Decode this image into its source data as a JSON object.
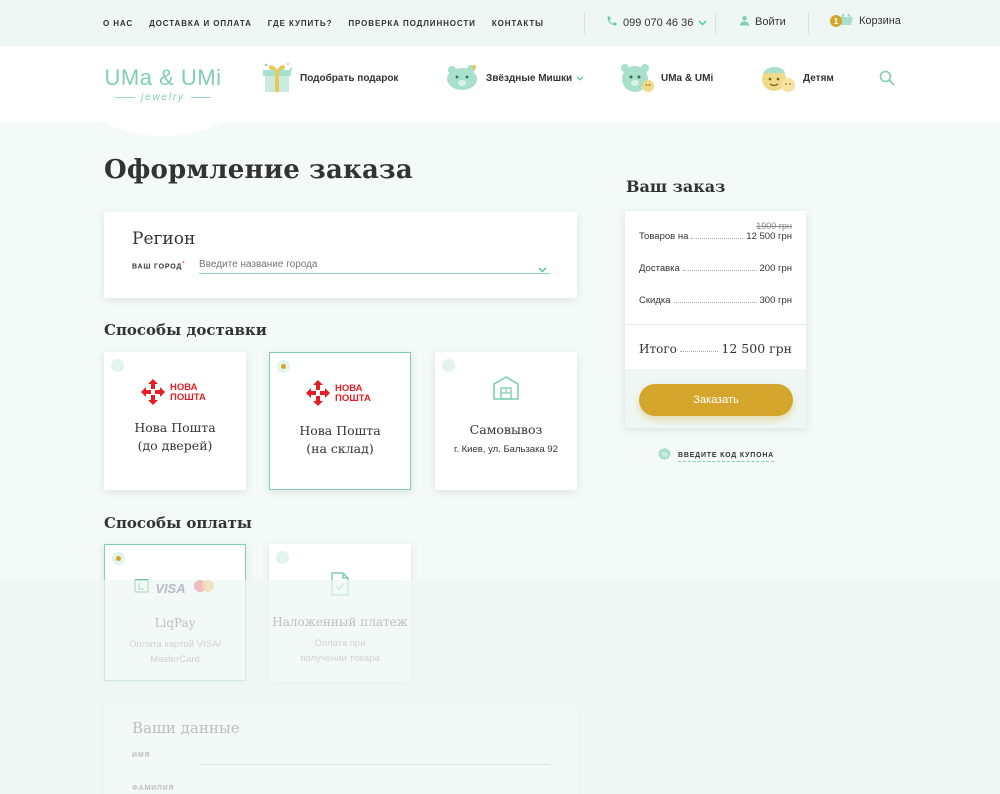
{
  "topbar": {
    "nav": [
      "О нас",
      "Доставка и оплата",
      "Где купить?",
      "Проверка подлинности",
      "Контакты"
    ],
    "phone": "099 070 46 36",
    "login": "Войти",
    "cart_count": "1",
    "cart_label": "Корзина"
  },
  "header": {
    "logo_main": "UMa & UMi",
    "logo_sub": "jewelry",
    "nav": [
      {
        "label": "Подобрать подарок",
        "icon": "gift-icon"
      },
      {
        "label": "Звёздные Мишки",
        "icon": "bear-icon"
      },
      {
        "label": "UMa & UMi",
        "icon": "bears-icon"
      },
      {
        "label": "Детям",
        "icon": "kids-icon"
      }
    ]
  },
  "page": {
    "title": "Оформление заказа"
  },
  "region": {
    "title": "Регион",
    "city_label": "Ваш город",
    "city_required": "*",
    "city_placeholder": "Введите название города"
  },
  "delivery": {
    "title": "Способы доставки",
    "options": [
      {
        "logo_line1": "НОВА",
        "logo_line2": "ПОШТА",
        "name_line1": "Нова Пошта",
        "name_line2": "(до дверей)",
        "selected": false
      },
      {
        "logo_line1": "НОВА",
        "logo_line2": "ПОШТА",
        "name_line1": "Нова Пошта",
        "name_line2": "(на склад)",
        "selected": true
      },
      {
        "name_line1": "Самовывоз",
        "address": "г. Киев, ул. Бальзака 92",
        "selected": false
      }
    ]
  },
  "payment": {
    "title": "Способы оплаты",
    "options": [
      {
        "visa_text": "VISA",
        "name": "LiqPay",
        "desc_line1": "Оплата картой VISA/",
        "desc_line2": "MasterCard",
        "selected": true
      },
      {
        "name": "Наложенный платеж",
        "desc_line1": "Оплата при",
        "desc_line2": "получении товара",
        "selected": false
      }
    ]
  },
  "user": {
    "title": "Ваши данные",
    "field1_label": "Имя",
    "field2_label": "Фамилия"
  },
  "order": {
    "title": "Ваш заказ",
    "old_price": "1900 грн",
    "goods_label": "Товаров на",
    "goods_value": "12 500 грн",
    "delivery_label": "Доставка",
    "delivery_value": "200 грн",
    "discount_label": "Скидка",
    "discount_value": "300 грн",
    "total_label": "Итого",
    "total_value": "12 500 грн",
    "button": "Заказать",
    "coupon": "Введите код купона"
  },
  "colors": {
    "accent": "#7fcfb4",
    "gold": "#d4a72c",
    "novaposhta_red": "#e31e24"
  }
}
